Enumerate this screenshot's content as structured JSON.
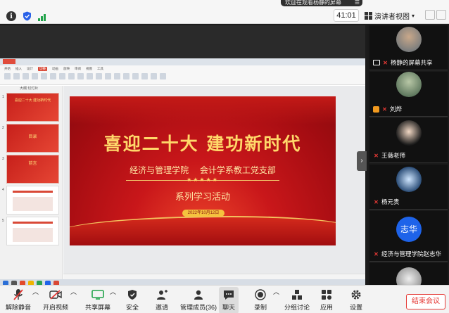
{
  "topbar": {
    "banner_text": "欢迎在观看杨静的屏幕",
    "timer": "41:01",
    "view_label": "演讲者视图",
    "icons": [
      "info-icon",
      "shield-icon",
      "signal-icon",
      "grid-icon",
      "chevron-down-icon"
    ]
  },
  "slide": {
    "title": "喜迎二十大  建功新时代",
    "subtitle": "经济与管理学院  会计学系教工党支部",
    "subtitle2": "系列学习活动",
    "date": "2022年10月12日",
    "stars": "★★★★★"
  },
  "thumbnails": {
    "tabs": "大纲  幻灯片",
    "items": [
      {
        "num": "1",
        "text": "喜迎二十大 建功新时代"
      },
      {
        "num": "2",
        "text": "目录"
      },
      {
        "num": "3",
        "text": "前言"
      },
      {
        "num": "4",
        "text": ""
      },
      {
        "num": "5",
        "text": ""
      }
    ]
  },
  "participants": [
    {
      "name": "杨静的屏幕共享",
      "status": "screen-share"
    },
    {
      "name": "刘烨",
      "status": "host-muted"
    },
    {
      "name": "王薇老师",
      "status": "muted"
    },
    {
      "name": "杨元贵",
      "status": "muted"
    },
    {
      "name": "经济与管理学院赵志华",
      "status": "muted",
      "avatar_text": "志华"
    },
    {
      "name": "",
      "status": ""
    }
  ],
  "toolbar": {
    "unmute": "解除静音",
    "video": "开启视频",
    "share": "共享屏幕",
    "security": "安全",
    "invite": "邀请",
    "members": "管理成员(36)",
    "chat": "聊天",
    "record": "录制",
    "breakout": "分组讨论",
    "apps": "应用",
    "settings": "设置",
    "end": "结束会议"
  },
  "colors": {
    "accent_red": "#e53935",
    "slide_gold": "#ffd86a",
    "slide_red": "#c9171a",
    "avatar_blue": "#1e63e9"
  }
}
